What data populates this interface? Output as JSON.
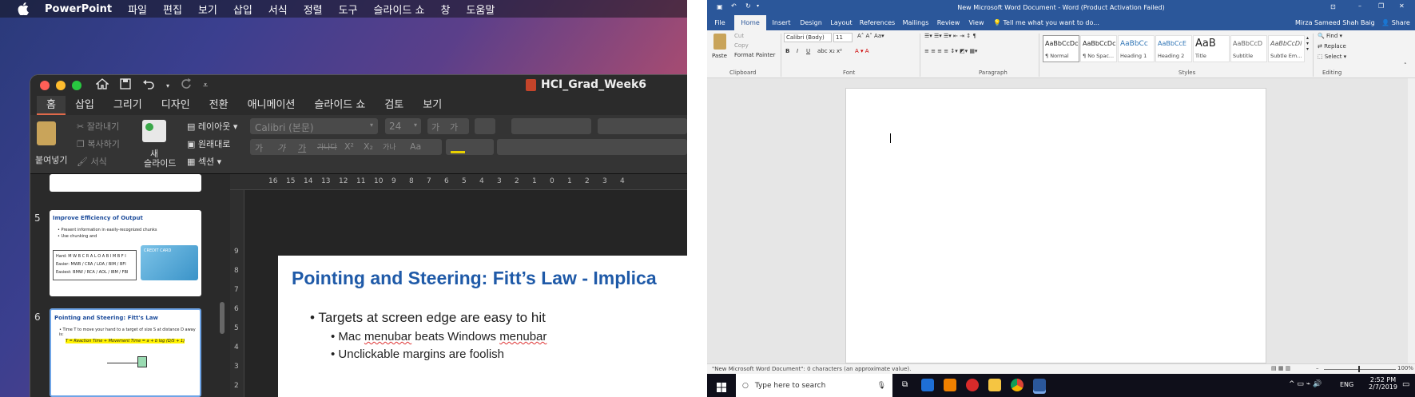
{
  "mac": {
    "menubar": {
      "app_name": "PowerPoint",
      "items": [
        "파일",
        "편집",
        "보기",
        "삽입",
        "서식",
        "정렬",
        "도구",
        "슬라이드 쇼",
        "창",
        "도움말"
      ]
    },
    "window": {
      "doc_title": "HCI_Grad_Week6",
      "tabs": [
        "홈",
        "삽입",
        "그리기",
        "디자인",
        "전환",
        "애니메이션",
        "슬라이드 쇼",
        "검토",
        "보기"
      ],
      "ribbon": {
        "paste": "붙여넣기",
        "cut": "잘라내기",
        "copy": "복사하기",
        "format": "서식",
        "new_slide_1": "새",
        "new_slide_2": "슬라이드",
        "layout": "레이아웃",
        "reset": "원래대로",
        "section": "섹션",
        "font_name": "Calibri (본문)",
        "font_size": "24",
        "grow": "가",
        "shrink": "가",
        "bold": "가",
        "italic": "가",
        "underline": "가",
        "strike": "가나다",
        "sup": "X",
        "sub": "X",
        "spacing": "가나",
        "change_case": "Aa"
      },
      "thumbnails": [
        {
          "number": "5",
          "title": "Improve Efficiency of Output",
          "bullets": [
            "Present information in easily-recognized chunks",
            "Use chunking and"
          ],
          "box_lines": [
            "Hard: M W B C R A L O A B I M B F I",
            "Easier: MWB / CRA / LOA / BIM / BFI",
            "Easiest: BMW / RCA / AOL / IBM / FBI"
          ],
          "card_label": "CREDIT CARD"
        },
        {
          "number": "6",
          "title": "Pointing and Steering: Fitt's Law",
          "bullets": [
            "Time T to move your hand to a target of size S at distance D away is:"
          ],
          "formula": "T = Reaction Time + Movement Time = a + b log (D/S + 1)"
        }
      ],
      "ruler_numbers": [
        "16",
        "15",
        "14",
        "13",
        "12",
        "11",
        "10",
        "9",
        "8",
        "7",
        "6",
        "5",
        "4",
        "3",
        "2",
        "1",
        "0",
        "1",
        "2",
        "3",
        "4"
      ],
      "vruler_numbers": [
        "9",
        "8",
        "7",
        "6",
        "5",
        "4",
        "3",
        "2"
      ],
      "slide": {
        "title": "Pointing and Steering: Fitt’s Law - Implica",
        "bullet_1": "Targets at screen edge are easy to hit",
        "bullet_2a": "Mac ",
        "bullet_2b": "menubar",
        "bullet_2c": " beats Windows ",
        "bullet_2d": "menubar",
        "bullet_3": "Unclickable margins are foolish"
      }
    }
  },
  "word": {
    "title": "New Microsoft Word Document - Word (Product Activation Failed)",
    "tabs": [
      "File",
      "Home",
      "Insert",
      "Design",
      "Layout",
      "References",
      "Mailings",
      "Review",
      "View"
    ],
    "tell_me": "Tell me what you want to do...",
    "user": "Mirza Sameed Shah Baig",
    "share": "Share",
    "clipboard": {
      "paste": "Paste",
      "cut": "Cut",
      "copy": "Copy",
      "format_painter": "Format Painter",
      "group": "Clipboard"
    },
    "font": {
      "name": "Calibri (Body)",
      "size": "11",
      "group": "Font"
    },
    "paragraph_group": "Paragraph",
    "styles": [
      {
        "preview": "AaBbCcDc",
        "name": "¶ Normal"
      },
      {
        "preview": "AaBbCcDc",
        "name": "¶ No Spac..."
      },
      {
        "preview": "AaBbCc",
        "name": "Heading 1"
      },
      {
        "preview": "AaBbCcE",
        "name": "Heading 2"
      },
      {
        "preview": "AaB",
        "name": "Title"
      },
      {
        "preview": "AaBbCcD",
        "name": "Subtitle"
      },
      {
        "preview": "AaBbCcDi",
        "name": "Subtle Em..."
      }
    ],
    "styles_group": "Styles",
    "editing": {
      "find": "Find",
      "replace": "Replace",
      "select": "Select",
      "group": "Editing"
    },
    "status": "\"New Microsoft Word Document\": 0 characters (an approximate value).",
    "zoom": "100%",
    "taskbar": {
      "search": "Type here to search",
      "lang": "ENG",
      "time": "2:52 PM",
      "date": "2/7/2019"
    },
    "colors": {
      "accent": "#2b579a",
      "taskbar": "#0f0f1a"
    }
  }
}
